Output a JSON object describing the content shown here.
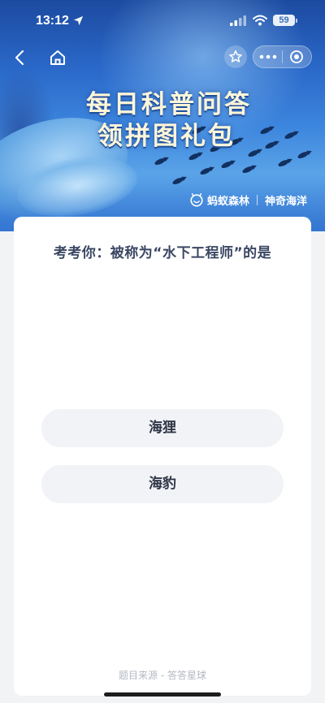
{
  "status_bar": {
    "time": "13:12",
    "battery": "59"
  },
  "nav": {
    "back_icon": "chevron-left-icon",
    "home_icon": "home-icon",
    "favorite_icon": "star-icon",
    "more_icon": "more-dots-icon",
    "close_icon": "target-circle-icon"
  },
  "banner": {
    "title_line1": "每日科普问答",
    "title_line2": "领拼图礼包",
    "brand_left": "蚂蚁森林",
    "brand_right": "神奇海洋"
  },
  "quiz": {
    "question": "考考你：被称为“水下工程师”的是",
    "options": [
      {
        "label": "海狸"
      },
      {
        "label": "海豹"
      }
    ],
    "source": "题目来源 - 答答星球"
  },
  "colors": {
    "banner_top": "#1c4aa0",
    "banner_mid": "#3d86de",
    "title_text": "#fff6d8",
    "question_text": "#3b4763",
    "option_bg": "#f1f3f6",
    "page_bg": "#f2f3f5"
  }
}
